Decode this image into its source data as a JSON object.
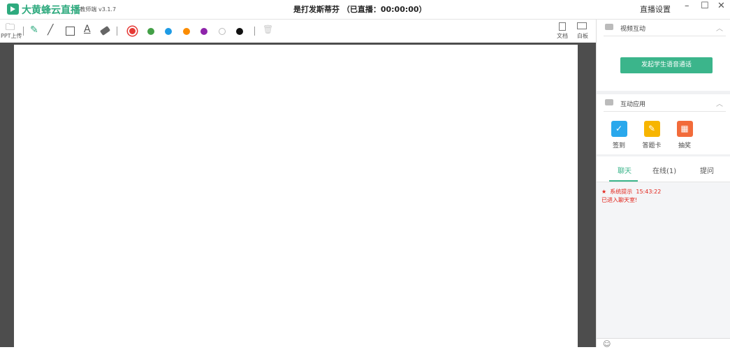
{
  "titlebar": {
    "app_name": "大黄蜂云直播",
    "version": "- 教师端 v3.1.7",
    "course_title": "是打发斯蒂芬 （已直播：00:00:00）",
    "settings": "直播设置",
    "minimize": "–",
    "maximize": "☐",
    "close": "✕"
  },
  "toolbar": {
    "upload_label": "PPT上传",
    "doc_label": "文档",
    "whiteboard_label": "白板",
    "colors": [
      "#e53935",
      "#43a047",
      "#1e9be5",
      "#fb8c00",
      "#8e24aa",
      "#ffffff",
      "#111111"
    ]
  },
  "side": {
    "video_section": "视频互动",
    "voice_call_button": "发起学生语音通话",
    "apps_section": "互动应用",
    "apps": [
      {
        "label": "签到",
        "color": "#2aa8ec"
      },
      {
        "label": "答题卡",
        "color": "#f7b500"
      },
      {
        "label": "抽奖",
        "color": "#f26b3a"
      }
    ],
    "tabs": [
      "聊天",
      "在线(1)",
      "提问"
    ],
    "messages": [
      {
        "sender": "系统提示",
        "time": "15:43:22",
        "text": "已进入聊天室!"
      }
    ]
  }
}
